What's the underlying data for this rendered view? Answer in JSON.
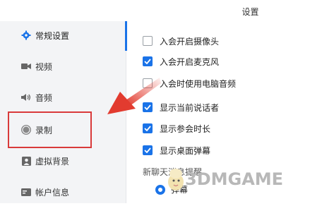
{
  "window": {
    "title": "设置"
  },
  "sidebar": {
    "items": [
      {
        "label": "常规设置",
        "icon": "gear-icon"
      },
      {
        "label": "视频",
        "icon": "video-camera-icon"
      },
      {
        "label": "音频",
        "icon": "speaker-icon"
      },
      {
        "label": "录制",
        "icon": "record-icon"
      },
      {
        "label": "虚拟背景",
        "icon": "portrait-icon"
      },
      {
        "label": "帐户信息",
        "icon": "id-card-icon"
      }
    ],
    "active_index": 0
  },
  "settings": {
    "options": [
      {
        "label": "入会开启摄像头",
        "checked": false
      },
      {
        "label": "入会开启麦克风",
        "checked": true
      },
      {
        "label": "入会时使用电脑音频",
        "checked": false
      },
      {
        "label": "显示当前说话者",
        "checked": true
      },
      {
        "label": "显示参会时长",
        "checked": true
      },
      {
        "label": "显示桌面弹幕",
        "checked": true
      }
    ],
    "chat_section_title": "新聊天消息提醒",
    "chat_radio_label": "弹幕"
  },
  "colors": {
    "accent": "#1a73e8",
    "highlight_box": "#d93a3a",
    "arrow": "#e23b2f"
  },
  "watermark": {
    "text": "3DMGAME"
  }
}
